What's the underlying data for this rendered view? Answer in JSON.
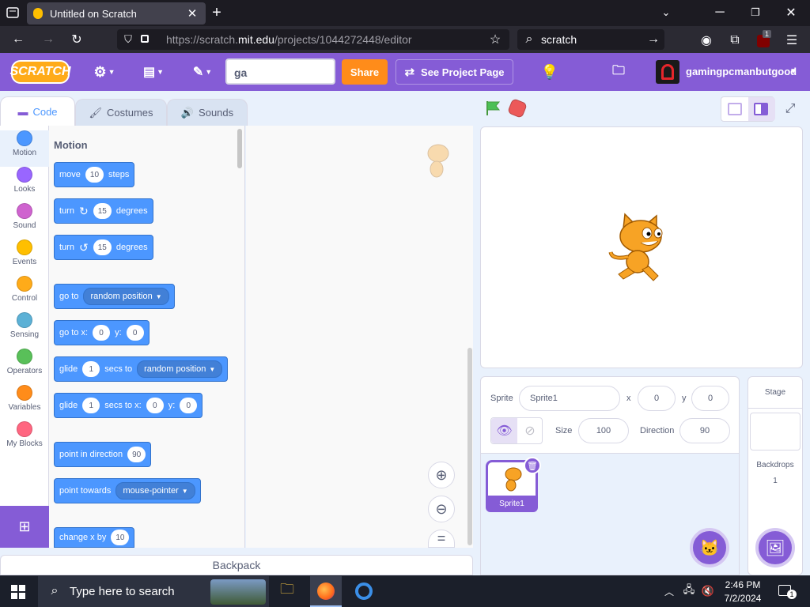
{
  "browser": {
    "tab_title": "Untitled on Scratch",
    "url_prefix": "https://scratch.",
    "url_domain": "mit.edu",
    "url_path": "/projects/1044272448/editor",
    "search_text": "scratch",
    "extension_badge": "1"
  },
  "menubar": {
    "logo": "SCRATCH",
    "project_title": "ga",
    "share_label": "Share",
    "see_project_label": "See Project Page",
    "username": "gamingpcmanbutgood",
    "colors": {
      "bar": "#855cd6",
      "share": "#ff8c1a"
    }
  },
  "tabs": [
    {
      "label": "Code",
      "active": true
    },
    {
      "label": "Costumes",
      "active": false
    },
    {
      "label": "Sounds",
      "active": false
    }
  ],
  "categories": [
    {
      "label": "Motion",
      "color": "#4c97ff"
    },
    {
      "label": "Looks",
      "color": "#9966ff"
    },
    {
      "label": "Sound",
      "color": "#cf63cf"
    },
    {
      "label": "Events",
      "color": "#ffbf00"
    },
    {
      "label": "Control",
      "color": "#ffab19"
    },
    {
      "label": "Sensing",
      "color": "#5cb1d6"
    },
    {
      "label": "Operators",
      "color": "#59c059"
    },
    {
      "label": "Variables",
      "color": "#ff8c1a"
    },
    {
      "label": "My Blocks",
      "color": "#ff6680"
    }
  ],
  "palette": {
    "heading": "Motion",
    "blocks": {
      "move": {
        "pre": "move",
        "val": "10",
        "post": "steps"
      },
      "turn_right": {
        "pre": "turn",
        "val": "15",
        "post": "degrees"
      },
      "turn_left": {
        "pre": "turn",
        "val": "15",
        "post": "degrees"
      },
      "goto": {
        "pre": "go to",
        "drop": "random position"
      },
      "gotoxy": {
        "pre": "go to x:",
        "x": "0",
        "ylabel": "y:",
        "y": "0"
      },
      "glide_to": {
        "pre": "glide",
        "val": "1",
        "mid": "secs to",
        "drop": "random position"
      },
      "glide_xy": {
        "pre": "glide",
        "val": "1",
        "mid": "secs to x:",
        "x": "0",
        "ylabel": "y:",
        "y": "0"
      },
      "point_dir": {
        "pre": "point in direction",
        "val": "90"
      },
      "point_towards": {
        "pre": "point towards",
        "drop": "mouse-pointer"
      },
      "change_x": {
        "pre": "change x by",
        "val": "10"
      }
    }
  },
  "sprite_info": {
    "sprite_label": "Sprite",
    "sprite_name": "Sprite1",
    "x_label": "x",
    "x": "0",
    "y_label": "y",
    "y": "0",
    "size_label": "Size",
    "size": "100",
    "direction_label": "Direction",
    "direction": "90"
  },
  "sprites": [
    {
      "name": "Sprite1"
    }
  ],
  "stage_panel": {
    "title": "Stage",
    "backdrops_label": "Backdrops",
    "backdrops_count": "1"
  },
  "backpack_label": "Backpack",
  "taskbar": {
    "search_placeholder": "Type here to search",
    "time": "2:46 PM",
    "date": "7/2/2024",
    "notif_count": "1"
  }
}
